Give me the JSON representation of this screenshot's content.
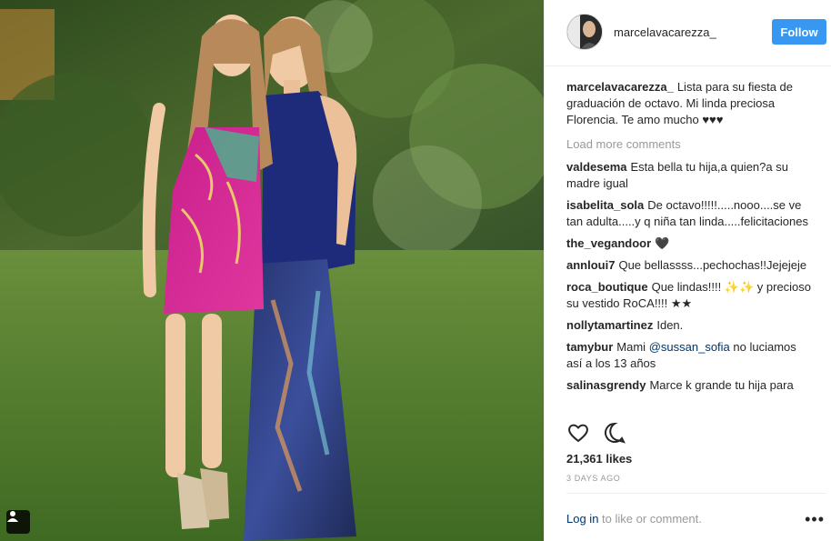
{
  "post": {
    "username": "marcelavacarezza_",
    "follow_label": "Follow",
    "caption": {
      "user": "marcelavacarezza_",
      "text": "Lista para su fiesta de graduación de octavo. Mi linda preciosa Florencia. Te amo mucho ♥♥♥"
    },
    "load_more": "Load more comments",
    "comments": [
      {
        "user": "valdesema",
        "text": "Esta bella tu hija,a quien?a su madre igual"
      },
      {
        "user": "isabelita_sola",
        "text": "De octavo!!!!!.....nooo....se ve tan adulta.....y q niña tan linda.....felicitaciones"
      },
      {
        "user": "the_vegandoor",
        "text": "🖤"
      },
      {
        "user": "annloui7",
        "text": "Que bellassss...pechochas!!Jejejeje"
      },
      {
        "user": "roca_boutique",
        "text": "Que lindas!!!! ✨✨ y precioso su vestido RoCA!!!! ★★"
      },
      {
        "user": "nollytamartinez",
        "text": "Iden."
      },
      {
        "user": "tamybur",
        "text_before": "Mami",
        "mention": "@sussan_sofia",
        "text_after": "no luciamos así a los 13 años"
      },
      {
        "user": "salinasgrendy",
        "text": "Marce k grande tu hija para"
      }
    ],
    "likes": "21,361 likes",
    "time_ago": "3 DAYS AGO",
    "login_link": "Log in",
    "login_rest": "to like or comment.",
    "more_label": "•••",
    "icons": [
      "heart-icon",
      "comment-icon",
      "user-tag-icon",
      "more-options-icon"
    ],
    "colors": {
      "accent": "#3897f0",
      "link": "#003569",
      "muted": "#999999",
      "border": "#efefef"
    }
  }
}
